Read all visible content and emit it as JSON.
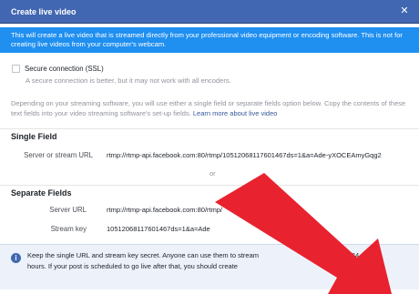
{
  "dialog": {
    "title": "Create live video",
    "close_icon": "close-icon"
  },
  "info_banner": {
    "text": "This will create a live video that is streamed directly from your professional video equipment or encoding software. This is not for creating live videos from your computer's webcam."
  },
  "secure_connection": {
    "label": "Secure connection (SSL)",
    "help": "A secure connection is better, but it may not work with all encoders."
  },
  "description": {
    "text": "Depending on your streaming software, you will use either a single field or separate fields option below. Copy the contents of these text fields into your video streaming software's set-up fields. ",
    "link": "Learn more about live video"
  },
  "single_field": {
    "heading": "Single Field",
    "label": "Server or stream URL",
    "value": "rtmp://rtmp-api.facebook.com:80/rtmp/10512068117601467ds=1&a=Ade-yXOCEAmyGqg2"
  },
  "or_label": "or",
  "separate_fields": {
    "heading": "Separate Fields",
    "server_label": "Server URL",
    "server_value": "rtmp://rtmp-api.facebook.com:80/rtmp/",
    "key_label": "Stream key",
    "key_value": "10512068117601467ds=1&a=Ade"
  },
  "notice": {
    "line1": "Keep the single URL and stream key secret. Anyone can use them to stream",
    "line1_end": "y is valid for 24",
    "line2": "hours. If your post is scheduled to go live after that, you should create"
  },
  "colors": {
    "header": "#4267b2",
    "info": "#1f8ff0",
    "arrow": "#e8222e"
  }
}
